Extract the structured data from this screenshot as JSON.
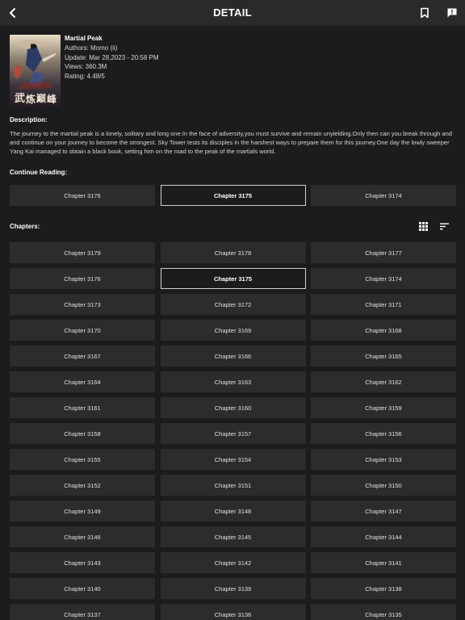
{
  "header": {
    "title": "DETAIL"
  },
  "manga": {
    "title": "Martial Peak",
    "authors": "Authors: Momo (ii)",
    "update": "Update: Mar 28,2023 - 20:58 PM",
    "views": "Views: 360.3M",
    "rating": "Rating: 4.48/5"
  },
  "description": {
    "label": "Description:",
    "text": "The journey to the martial peak is a lonely, solitary and long one.In the face of adversity,you must survive and remain unyielding.Only then can you break through and and continue on your journey to become the strongest. Sky Tower tests its disciples in the harshest ways to prepare them for this journey.One day the lowly sweeper Yang Kai managed to obtain a black book, setting him on the road to the peak of the martials world."
  },
  "continue_reading": {
    "label": "Continue Reading:",
    "items": [
      "Chapter 3176",
      "Chapter 3175",
      "Chapter 3174"
    ],
    "active": "Chapter 3175"
  },
  "chapters": {
    "label": "Chapters:",
    "items": [
      "Chapter 3179",
      "Chapter 3178",
      "Chapter 3177",
      "Chapter 3176",
      "Chapter 3175",
      "Chapter 3174",
      "Chapter 3173",
      "Chapter 3172",
      "Chapter 3171",
      "Chapter 3170",
      "Chapter 3169",
      "Chapter 3168",
      "Chapter 3167",
      "Chapter 3166",
      "Chapter 3165",
      "Chapter 3164",
      "Chapter 3163",
      "Chapter 3162",
      "Chapter 3161",
      "Chapter 3160",
      "Chapter 3159",
      "Chapter 3158",
      "Chapter 3157",
      "Chapter 3156",
      "Chapter 3155",
      "Chapter 3154",
      "Chapter 3153",
      "Chapter 3152",
      "Chapter 3151",
      "Chapter 3150",
      "Chapter 3149",
      "Chapter 3148",
      "Chapter 3147",
      "Chapter 3146",
      "Chapter 3145",
      "Chapter 3144",
      "Chapter 3143",
      "Chapter 3142",
      "Chapter 3141",
      "Chapter 3140",
      "Chapter 3139",
      "Chapter 3138",
      "Chapter 3137",
      "Chapter 3136",
      "Chapter 3135"
    ],
    "active": "Chapter 3175"
  },
  "icons": {
    "back": "chevron-left-icon",
    "bookmark": "bookmark-icon",
    "report": "report-icon",
    "grid_view": "grid-icon",
    "sort": "sort-icon"
  },
  "colors": {
    "background": "#1c1c1e",
    "header": "#2a2a2c",
    "chip": "#2c2c2e",
    "active_border": "#d0d0d0",
    "text": "#e6e6e6"
  }
}
